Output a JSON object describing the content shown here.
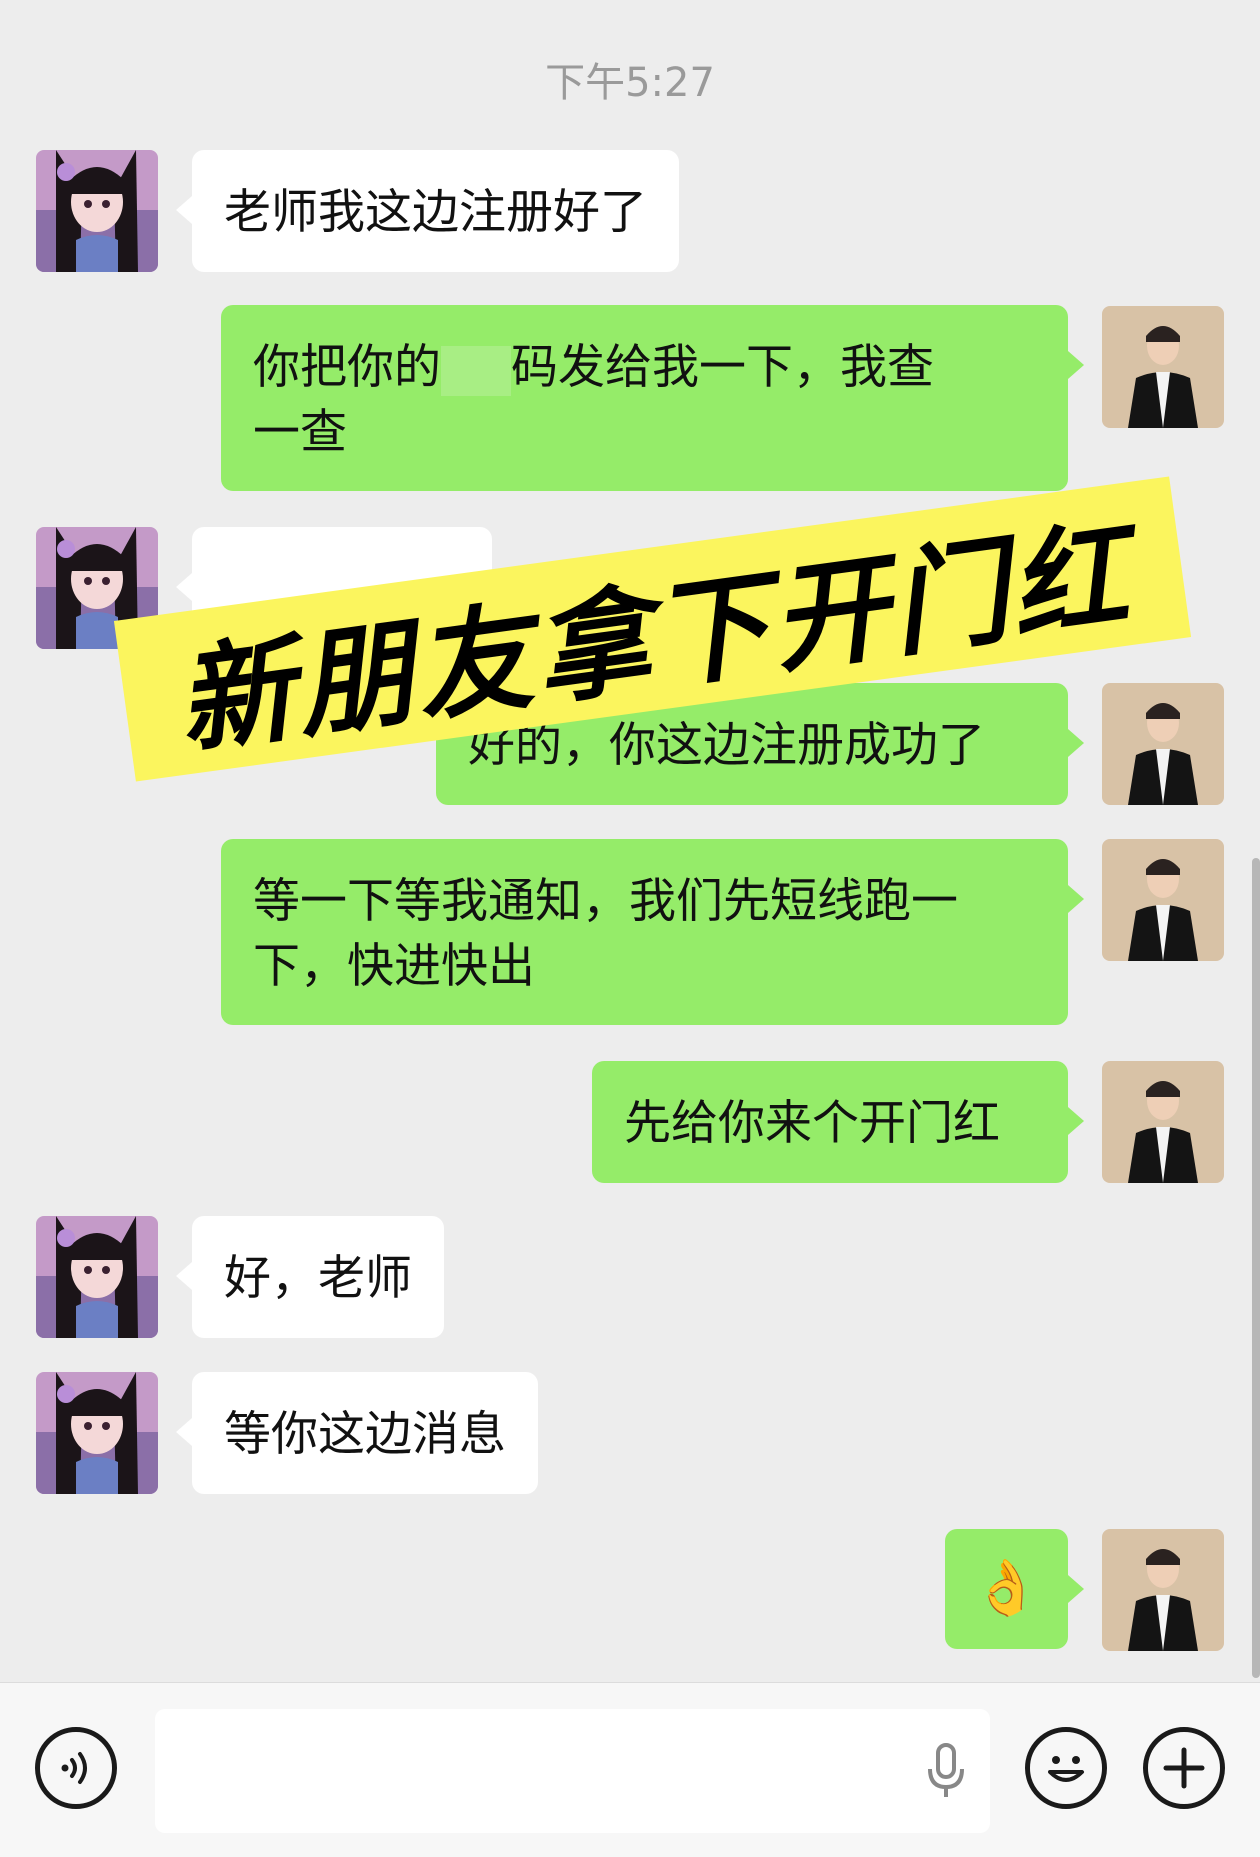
{
  "timestamp": "下午5:27",
  "banner": {
    "text": "新朋友拿下开门红"
  },
  "messages": [
    {
      "side": "left",
      "text": "老师我这边注册好了"
    },
    {
      "side": "right",
      "text_a": "你把你的",
      "text_b": "码发给我一下，我查",
      "text_c": "一查"
    },
    {
      "side": "left",
      "text": ""
    },
    {
      "side": "right",
      "text": "好的，你这边注册成功了"
    },
    {
      "side": "right",
      "text_a": "等一下等我通知，我们先短线跑一",
      "text_b": "下，快进快出"
    },
    {
      "side": "right",
      "text": "先给你来个开门红"
    },
    {
      "side": "left",
      "text": "好，老师"
    },
    {
      "side": "left",
      "text": "等你这边消息"
    },
    {
      "side": "right",
      "text": "👌"
    }
  ],
  "input": {
    "placeholder": ""
  },
  "icons": {
    "voice": "voice-mode-icon",
    "mic": "microphone-icon",
    "emoji": "emoji-icon",
    "plus": "plus-icon"
  },
  "colors": {
    "background": "#ededed",
    "self_bubble": "#95ec69",
    "other_bubble": "#ffffff",
    "banner": "#fbf55e"
  }
}
